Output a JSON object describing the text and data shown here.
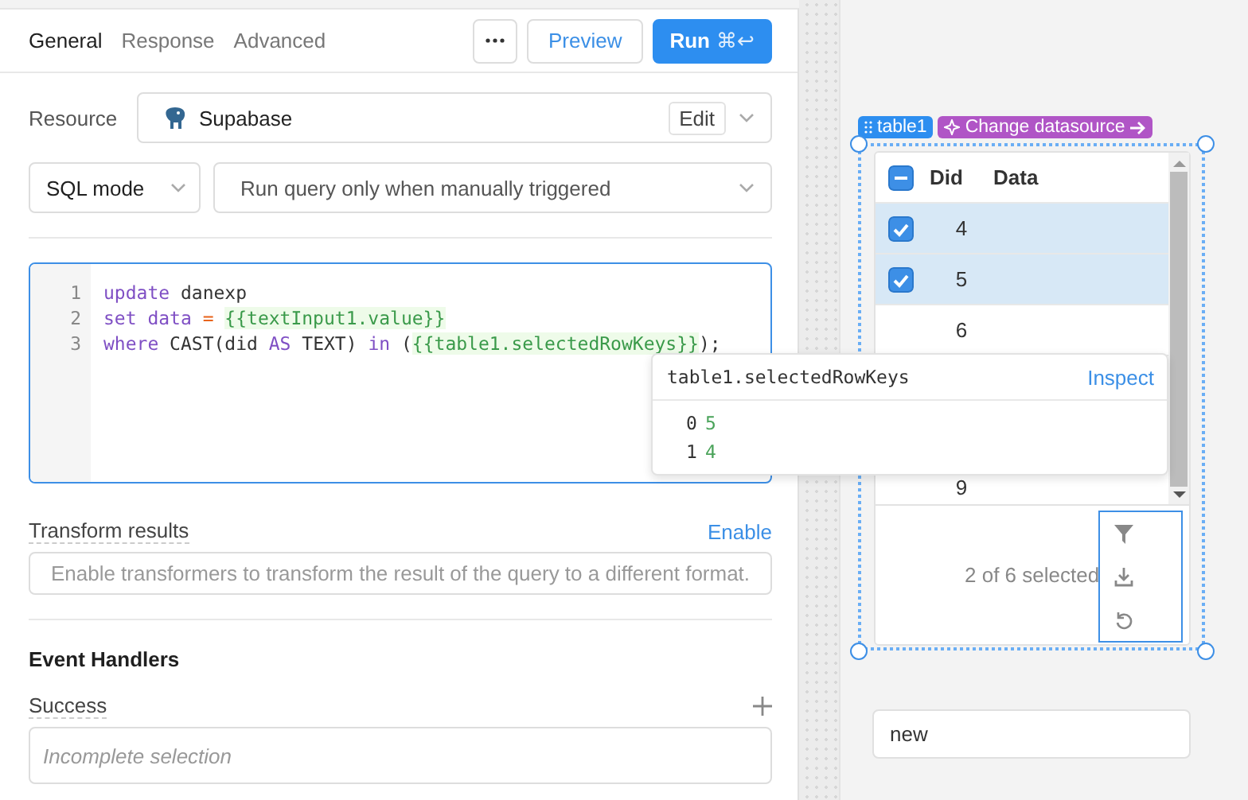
{
  "tabs": [
    {
      "label": "General",
      "selected": true
    },
    {
      "label": "Response",
      "selected": false
    },
    {
      "label": "Advanced",
      "selected": false
    }
  ],
  "actions": {
    "preview": "Preview",
    "run": "Run",
    "run_shortcut": "⌘↩"
  },
  "resource": {
    "label": "Resource",
    "value": "Supabase",
    "edit": "Edit"
  },
  "mode": {
    "value": "SQL mode"
  },
  "trigger": {
    "value": "Run query only when manually triggered"
  },
  "code_lines": [
    {
      "number": "1",
      "tokens": [
        {
          "kind": "keyword",
          "text": "update"
        },
        {
          "kind": "plain",
          "text": " danexp"
        }
      ]
    },
    {
      "number": "2",
      "tokens": [
        {
          "kind": "keyword",
          "text": "set data"
        },
        {
          "kind": "operator",
          "text": " = "
        },
        {
          "kind": "template",
          "text": "{{textInput1.value}}"
        }
      ]
    },
    {
      "number": "3",
      "tokens": [
        {
          "kind": "keyword",
          "text": "where"
        },
        {
          "kind": "plain",
          "text": " CAST(did "
        },
        {
          "kind": "keyword",
          "text": "AS"
        },
        {
          "kind": "plain",
          "text": " TEXT) "
        },
        {
          "kind": "keyword",
          "text": "in"
        },
        {
          "kind": "plain",
          "text": " ("
        },
        {
          "kind": "template",
          "text": "{{table1.selectedRowKeys}}"
        },
        {
          "kind": "plain",
          "text": ");"
        }
      ]
    }
  ],
  "transform": {
    "label": "Transform results",
    "action": "Enable",
    "placeholder": "Enable transformers to transform the result of the query to a different format."
  },
  "event_handlers": {
    "title": "Event Handlers",
    "success_label": "Success",
    "placeholder": "Incomplete selection"
  },
  "table": {
    "name": "table1",
    "datasource_action": "Change datasource",
    "header_partially_checked": true,
    "columns": [
      "Did",
      "Data"
    ],
    "rows": [
      {
        "did": "4",
        "selected": true
      },
      {
        "did": "5",
        "selected": true
      },
      {
        "did": "6",
        "selected": false
      },
      {
        "did": "9",
        "selected": false
      }
    ],
    "footer": "2 of 6 selected"
  },
  "text_input": {
    "value": "new"
  },
  "popover": {
    "title": "table1.selectedRowKeys",
    "action": "Inspect",
    "entries": [
      {
        "index": "0",
        "value": "5"
      },
      {
        "index": "1",
        "value": "4"
      }
    ]
  }
}
